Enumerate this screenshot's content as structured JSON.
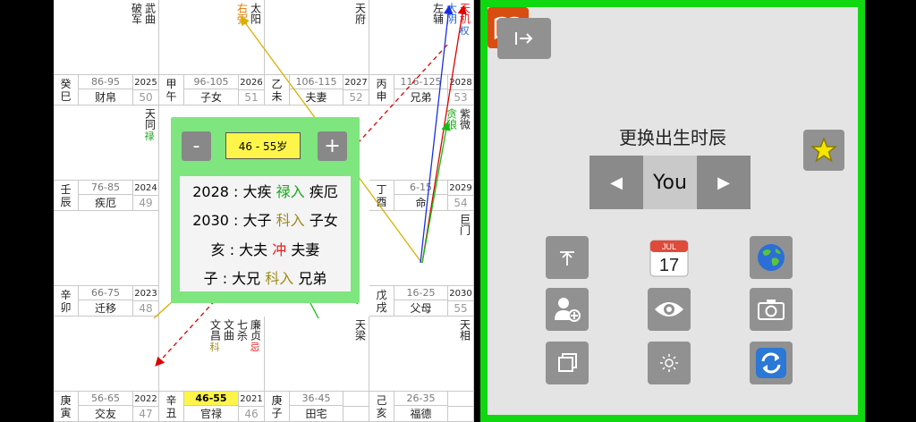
{
  "cells": [
    {
      "id": "si",
      "ganzhi": [
        "癸",
        "巳"
      ],
      "range": "86-95",
      "palace": "财帛",
      "year": "2025",
      "age": "50",
      "stars": [
        {
          "name": "武曲",
          "mark": ""
        },
        {
          "name": "破军",
          "mark": ""
        }
      ]
    },
    {
      "id": "wu",
      "ganzhi": [
        "甲",
        "午"
      ],
      "range": "96-105",
      "palace": "子女",
      "year": "2026",
      "age": "51",
      "stars": [
        {
          "name": "太阳",
          "mark": ""
        },
        {
          "name": "右弼",
          "mark": "",
          "color": "orange"
        }
      ]
    },
    {
      "id": "wei",
      "ganzhi": [
        "乙",
        "未"
      ],
      "range": "106-115",
      "palace": "夫妻",
      "year": "2027",
      "age": "52",
      "stars": [
        {
          "name": "天府",
          "mark": ""
        }
      ]
    },
    {
      "id": "shen",
      "ganzhi": [
        "丙",
        "申"
      ],
      "range": "116-125",
      "palace": "兄弟",
      "year": "2028",
      "age": "53",
      "stars": [
        {
          "name": "天机",
          "mark": "权",
          "color": "red",
          "mcolor": "blue"
        },
        {
          "name": "太阴",
          "mark": "",
          "color": "blue"
        },
        {
          "name": "左辅",
          "mark": ""
        }
      ]
    },
    {
      "id": "chen",
      "ganzhi": [
        "壬",
        "辰"
      ],
      "range": "76-85",
      "palace": "疾厄",
      "year": "2024",
      "age": "49",
      "stars": [
        {
          "name": "天同",
          "mark": "禄",
          "mcolor": "green"
        }
      ]
    },
    {
      "id": "you",
      "ganzhi": [
        "丁",
        "酉"
      ],
      "range": "6-15",
      "palace": "命",
      "year": "2029",
      "age": "54",
      "stars": [
        {
          "name": "紫微",
          "mark": ""
        },
        {
          "name": "贪狼",
          "mark": "",
          "color": "green"
        }
      ]
    },
    {
      "id": "mao",
      "ganzhi": [
        "辛",
        "卯"
      ],
      "range": "66-75",
      "palace": "迁移",
      "year": "2023",
      "age": "48",
      "stars": []
    },
    {
      "id": "xu",
      "ganzhi": [
        "戊",
        "戌"
      ],
      "range": "16-25",
      "palace": "父母",
      "year": "2030",
      "age": "55",
      "stars": [
        {
          "name": "巨门",
          "mark": ""
        }
      ]
    },
    {
      "id": "yin",
      "ganzhi": [
        "庚",
        "寅"
      ],
      "range": "56-65",
      "palace": "交友",
      "year": "2022",
      "age": "47",
      "stars": []
    },
    {
      "id": "chou",
      "ganzhi": [
        "辛",
        "丑"
      ],
      "range": "46-55",
      "palace": "官禄",
      "year": "2021",
      "age": "46",
      "stars": [
        {
          "name": "廉贞",
          "mark": "忌",
          "mcolor": "red"
        },
        {
          "name": "七杀",
          "mark": ""
        },
        {
          "name": "文曲",
          "mark": ""
        },
        {
          "name": "文昌",
          "mark": "科",
          "mcolor": "olive"
        }
      ]
    },
    {
      "id": "zi",
      "ganzhi": [
        "庚",
        "子"
      ],
      "range": "36-45",
      "palace": "田宅",
      "year": "",
      "age": "",
      "stars": [
        {
          "name": "天梁",
          "mark": ""
        }
      ]
    },
    {
      "id": "hai",
      "ganzhi": [
        "己",
        "亥"
      ],
      "range": "26-35",
      "palace": "福德",
      "year": "",
      "age": "",
      "stars": [
        {
          "name": "天相",
          "mark": ""
        }
      ]
    }
  ],
  "popup": {
    "minus": "-",
    "plus": "+",
    "range": "46 - 55岁",
    "lines": [
      {
        "pre": "2028 : 大疾 ",
        "hl": "禄入",
        "hlcolor": "green",
        "post": " 疾厄"
      },
      {
        "pre": "2030 : 大子 ",
        "hl": "科入",
        "hlcolor": "olive",
        "post": " 子女"
      },
      {
        "pre": "亥 : 大夫 ",
        "hl": "冲",
        "hlcolor": "red",
        "post": " 夫妻"
      },
      {
        "pre": "子 : 大兄 ",
        "hl": "科入",
        "hlcolor": "olive",
        "post": " 兄弟"
      }
    ]
  },
  "panel": {
    "title": "更换出生时辰",
    "hour_value": "You",
    "prev": "◀",
    "next": "▶",
    "calendar_month": "JUL",
    "calendar_day": "17"
  },
  "colors": {
    "green": "#1aa81a",
    "panel_green": "#10d810",
    "popup_green": "#7fe57f",
    "highlight_yellow": "#fff54a",
    "button_gray": "#919191",
    "book_orange": "#d84d10"
  }
}
